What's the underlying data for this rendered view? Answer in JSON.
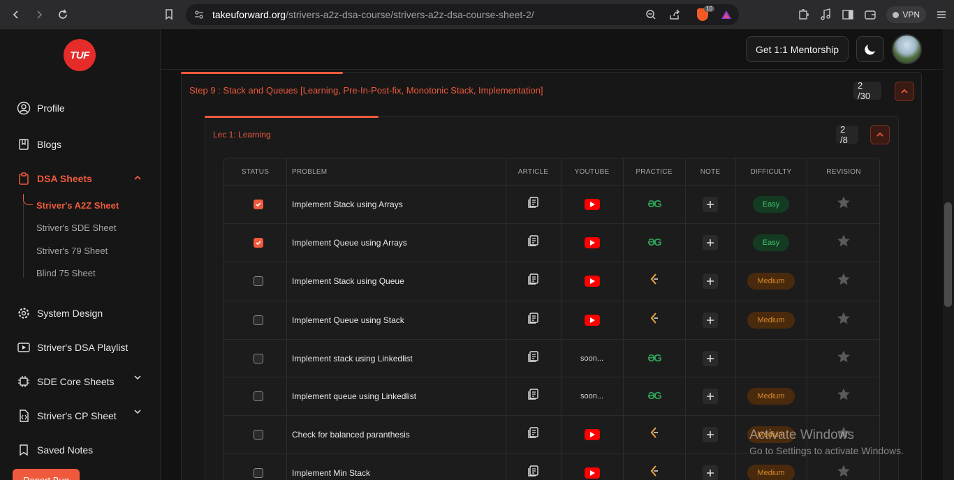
{
  "browser": {
    "url_host": "takeuforward.org",
    "url_path": "/strivers-a2z-dsa-course/strivers-a2z-dsa-course-sheet-2/",
    "brave_count": "10",
    "vpn_label": "VPN"
  },
  "sidebar": {
    "logo": "TUF",
    "items": [
      {
        "label": "Profile",
        "icon": "user-icon"
      },
      {
        "label": "Blogs",
        "icon": "book-icon"
      },
      {
        "label": "DSA Sheets",
        "icon": "clipboard-icon"
      },
      {
        "label": "System Design",
        "icon": "gear-icon"
      },
      {
        "label": "Striver's DSA Playlist",
        "icon": "play-icon"
      },
      {
        "label": "SDE Core Sheets",
        "icon": "chip-icon"
      },
      {
        "label": "Striver's CP Sheet",
        "icon": "code-file-icon"
      },
      {
        "label": "Saved Notes",
        "icon": "bookmark-icon"
      }
    ],
    "sub_items": [
      "Striver's A2Z Sheet",
      "Striver's SDE Sheet",
      "Striver's 79 Sheet",
      "Blind 75 Sheet"
    ],
    "report_label": "Report Bug"
  },
  "topbar": {
    "mentorship_label": "Get 1:1 Mentorship"
  },
  "step": {
    "title": "Step 9 : Stack and Queues [Learning, Pre-In-Post-fix, Monotonic Stack, Implementation]",
    "progress": "2 /30"
  },
  "lecture": {
    "title": "Lec 1: Learning",
    "progress": "2 /8"
  },
  "table": {
    "headers": [
      "STATUS",
      "PROBLEM",
      "ARTICLE",
      "YOUTUBE",
      "PRACTICE",
      "NOTE",
      "DIFFICULTY",
      "REVISION"
    ],
    "rows": [
      {
        "done": true,
        "problem": "Implement Stack using Arrays",
        "youtube": "video",
        "practice": "gfg",
        "difficulty": "Easy"
      },
      {
        "done": true,
        "problem": "Implement Queue using Arrays",
        "youtube": "video",
        "practice": "gfg",
        "difficulty": "Easy"
      },
      {
        "done": false,
        "problem": "Implement Stack using Queue",
        "youtube": "video",
        "practice": "leetcode",
        "difficulty": "Medium"
      },
      {
        "done": false,
        "problem": "Implement Queue using Stack",
        "youtube": "video",
        "practice": "leetcode",
        "difficulty": "Medium"
      },
      {
        "done": false,
        "problem": "Implement stack using Linkedlist",
        "youtube": "soon...",
        "practice": "gfg",
        "difficulty": ""
      },
      {
        "done": false,
        "problem": "Implement queue using Linkedlist",
        "youtube": "soon...",
        "practice": "gfg",
        "difficulty": "Medium"
      },
      {
        "done": false,
        "problem": "Check for balanced paranthesis",
        "youtube": "video",
        "practice": "leetcode",
        "difficulty": "Medium"
      },
      {
        "done": false,
        "problem": "Implement Min Stack",
        "youtube": "video",
        "practice": "leetcode",
        "difficulty": "Medium"
      }
    ]
  },
  "watermark": {
    "line1": "Activate Windows",
    "line2": "Go to Settings to activate Windows."
  },
  "colors": {
    "accent": "#ef5a3c",
    "easy": "#3cc06a",
    "medium": "#d98b2b",
    "youtube": "#ff0000",
    "gfg": "#2f9e58"
  }
}
